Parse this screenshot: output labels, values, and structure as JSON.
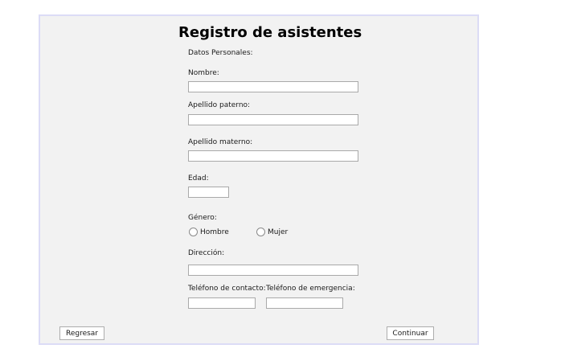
{
  "form": {
    "title": "Registro de asistentes",
    "section_label": "Datos Personales:",
    "nombre_label": "Nombre:",
    "nombre_value": "",
    "apellido_paterno_label": "Apellido paterno:",
    "apellido_paterno_value": "",
    "apellido_materno_label": "Apellido materno:",
    "apellido_materno_value": "",
    "edad_label": "Edad:",
    "edad_value": "",
    "genero_label": "Género:",
    "genero_options": [
      "Hombre",
      "Mujer"
    ],
    "direccion_label": "Dirección:",
    "direccion_value": "",
    "telefono_contacto_label": "Teléfono de contacto:",
    "telefono_contacto_value": "",
    "telefono_emergencia_label": "Teléfono de emergencia:",
    "telefono_emergencia_value": ""
  },
  "buttons": {
    "back_label": "Regresar",
    "continue_label": "Continuar"
  },
  "colors": {
    "window_background": "#f2f2f2",
    "window_border": "#dcdcf6"
  }
}
